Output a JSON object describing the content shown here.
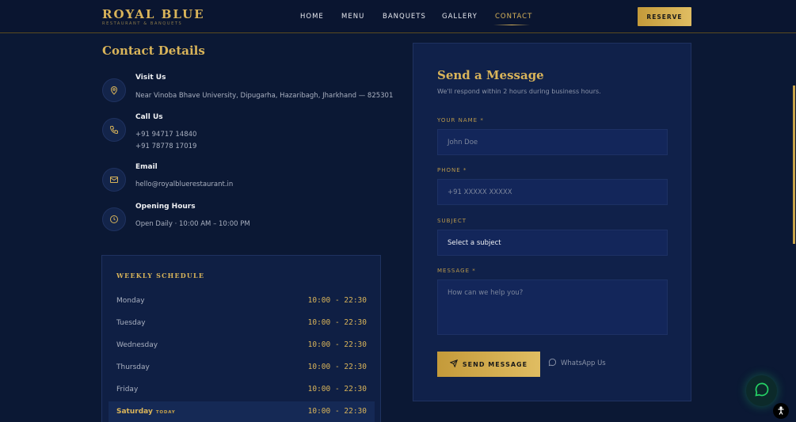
{
  "brand": {
    "name": "ROYAL BLUE",
    "tagline": "RESTAURANT & BANQUETS"
  },
  "nav": {
    "items": [
      "HOME",
      "MENU",
      "BANQUETS",
      "GALLERY",
      "CONTACT"
    ],
    "active": "CONTACT"
  },
  "reserve_label": "RESERVE",
  "contact": {
    "title": "Contact Details",
    "visit": {
      "label": "Visit Us",
      "value": "Near Vinoba Bhave University, Dipugarha, Hazaribagh, Jharkhand — 825301",
      "icon": "map-pin-icon"
    },
    "call": {
      "label": "Call Us",
      "phone1": "+91 94717 14840",
      "phone2": "+91 78778 17019",
      "icon": "phone-icon"
    },
    "email": {
      "label": "Email",
      "value": "hello@royalbluerestaurant.in",
      "icon": "mail-icon"
    },
    "hours": {
      "label": "Opening Hours",
      "value": "Open Daily · 10:00 AM – 10:00 PM",
      "icon": "clock-icon"
    }
  },
  "schedule": {
    "title": "WEEKLY SCHEDULE",
    "today_tag": "TODAY",
    "rows": [
      {
        "day": "Monday",
        "hours": "10:00 - 22:30"
      },
      {
        "day": "Tuesday",
        "hours": "10:00 - 22:30"
      },
      {
        "day": "Wednesday",
        "hours": "10:00 - 22:30"
      },
      {
        "day": "Thursday",
        "hours": "10:00 - 22:30"
      },
      {
        "day": "Friday",
        "hours": "10:00 - 22:30"
      },
      {
        "day": "Saturday",
        "hours": "10:00 - 22:30"
      }
    ]
  },
  "form": {
    "title": "Send a Message",
    "subtitle": "We'll respond within 2 hours during business hours.",
    "name_label": "YOUR NAME *",
    "name_placeholder": "John Doe",
    "phone_label": "PHONE *",
    "phone_placeholder": "+91 XXXXX XXXXX",
    "subject_label": "SUBJECT",
    "subject_value": "Select a subject",
    "message_label": "MESSAGE *",
    "message_placeholder": "How can we help you?",
    "send_label": "SEND MESSAGE",
    "whatsapp_label": "WhatsApp Us"
  },
  "colors": {
    "gold": "#d9b45a",
    "navy": "#0b1834",
    "whatsapp": "#25d366"
  }
}
